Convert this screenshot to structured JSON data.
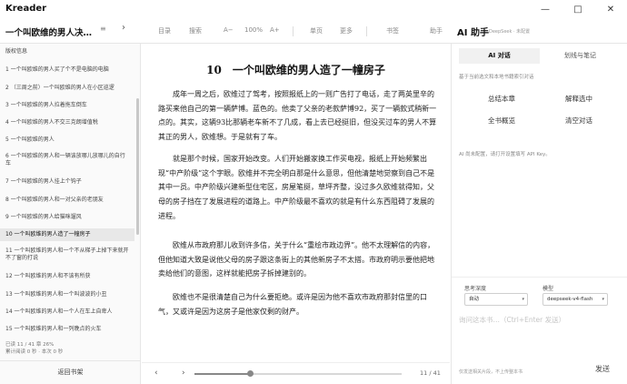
{
  "app": {
    "title": "Kreader",
    "window_controls": [
      "—",
      "□",
      "✕"
    ]
  },
  "toolbar": {
    "book_title": "一个叫欧维的男人决…",
    "menu_icon": "≡",
    "next_icon": "›",
    "toc_label": "目录",
    "search_label": "搜索",
    "font_decrease": "A−",
    "zoom": "100%",
    "font_increase": "A+",
    "single_page": "单页",
    "more": "更多",
    "bookmark": "书签",
    "assistant": "助手"
  },
  "ai_header": {
    "title": "AI 助手",
    "model_hint": "DeepSeek · 未配置"
  },
  "sidebar": {
    "items": [
      {
        "label": "版权信息",
        "active": false
      },
      {
        "label": "1 一个叫欧维的男人买了个不是电脑的电脑",
        "active": false
      },
      {
        "label": "2 （三周之前）一个叫欧维的男人在小区巡逻",
        "active": false
      },
      {
        "label": "3 一个叫欧维的男人拉着拖车倒车",
        "active": false
      },
      {
        "label": "4 一个叫欧维的男人不交三克朗增值税",
        "active": false
      },
      {
        "label": "5 一个叫欧维的男人",
        "active": false
      },
      {
        "label": "6 一个叫欧维的男人和一辆该放哪儿放哪儿的自行车",
        "active": false
      },
      {
        "label": "7 一个叫欧维的男人挂上个钩子",
        "active": false
      },
      {
        "label": "8 一个叫欧维的男人和一对父亲的老朋友",
        "active": false
      },
      {
        "label": "9 一个叫欧维的男人给猫咪遛风",
        "active": false
      },
      {
        "label": "10 一个叫欧维的男人造了一幢房子",
        "active": true
      },
      {
        "label": "11 一个叫欧维的男人和一个不从梯子上掉下来就开不了窗的打说",
        "active": false
      },
      {
        "label": "12 一个叫欧维的男人和不该有所获",
        "active": false
      },
      {
        "label": "13 一个叫欧维的男人和一个叫波波的小丑",
        "active": false
      },
      {
        "label": "14 一个叫欧维的男人和一个人在车上自卑人",
        "active": false
      },
      {
        "label": "15 一个叫欧维的男人和一列晚点的火车",
        "active": false
      }
    ],
    "status_line1": "已读 11 / 41 章 26%",
    "status_line2": "累计阅读 0 秒 · 本次 0 秒",
    "back_label": "返回书架"
  },
  "reader": {
    "chapter_title": "10　一个叫欧维的男人造了一幢房子",
    "paragraphs": [
      "成年一周之后，欧维过了驾考，按照报纸上的一则广告打了电话，走了两英里辛的路买来他自己的第一辆萨博。蓝色的。他卖了父亲的老款萨博92，买了一辆款式稍新一点的。其实，这辆93比那辆老车新不了几成，看上去已经挺旧，但没买过车的男人不算其正的男人，欧维想。于是就有了车。",
      "就是那个时候，国家开始改变。人们开始搬家换工作买电视，报纸上开始频繁出现“中产阶级”这个字眼。欧维并不完全明白那是什么意思，但他清楚地觉察到自己不是其中一员。中产阶级兴建新型住宅区，房屋笔挺，草坪齐整，没过多久欧维就得知，父母的房子挡在了发展进程的道路上。中产阶级最不喜欢的就是有什么东西阻碍了发展的进程。",
      "欧维从市政府那儿收到许多信，关于什么“重绘市政边界”。他不太理解信的内容，但他知道大致是说他父母的房子跟这条街上的其他新房子不太搭。市政府明示要他把地卖给他们的意图，这样就能把房子拆掉建别的。",
      "欧维也不是很清楚自己为什么要拒绝。或许是因为他不喜欢市政府那封信里的口气，又或许是因为这房子是他家仅剩的财产。"
    ]
  },
  "footer": {
    "prev_icon": "‹",
    "next_icon": "›",
    "progress": 0.27,
    "page_label": "11 / 41"
  },
  "ai_panel": {
    "tabs": [
      {
        "label": "AI 对话",
        "active": true
      },
      {
        "label": "划线与笔记",
        "active": false
      }
    ],
    "hint": "基于当前选文和本地书籍索引对话",
    "actions": [
      "总结本章",
      "解释选中",
      "全书概览",
      "清空对话"
    ],
    "note": "AI 尚未配置，请打开设置填写 API Key。",
    "depth_label": "思考深度",
    "depth_value": "自动",
    "model_label": "模型",
    "model_value": "deepseek-v4-flash",
    "input_placeholder": "询问这本书…（Ctrl+Enter 发送）",
    "footer_note": "仅发送相关片段，不上传整本书",
    "send_label": "发送"
  }
}
